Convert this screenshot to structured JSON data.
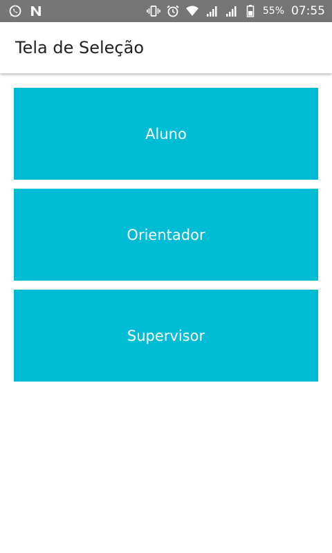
{
  "status_bar": {
    "left_icons": [
      "whatsapp-icon",
      "n-app-icon"
    ],
    "right_icons": [
      "vibrate-icon",
      "alarm-icon",
      "wifi-icon",
      "signal-icon",
      "signal-2-icon",
      "battery-icon"
    ],
    "battery_percent": "55%",
    "time": "07:55"
  },
  "app_bar": {
    "title": "Tela de Seleção"
  },
  "colors": {
    "accent": "#00bcd4",
    "status_bar": "#757575",
    "button_text": "#ffffff"
  },
  "buttons": [
    {
      "label": "Aluno"
    },
    {
      "label": "Orientador"
    },
    {
      "label": "Supervisor"
    }
  ]
}
